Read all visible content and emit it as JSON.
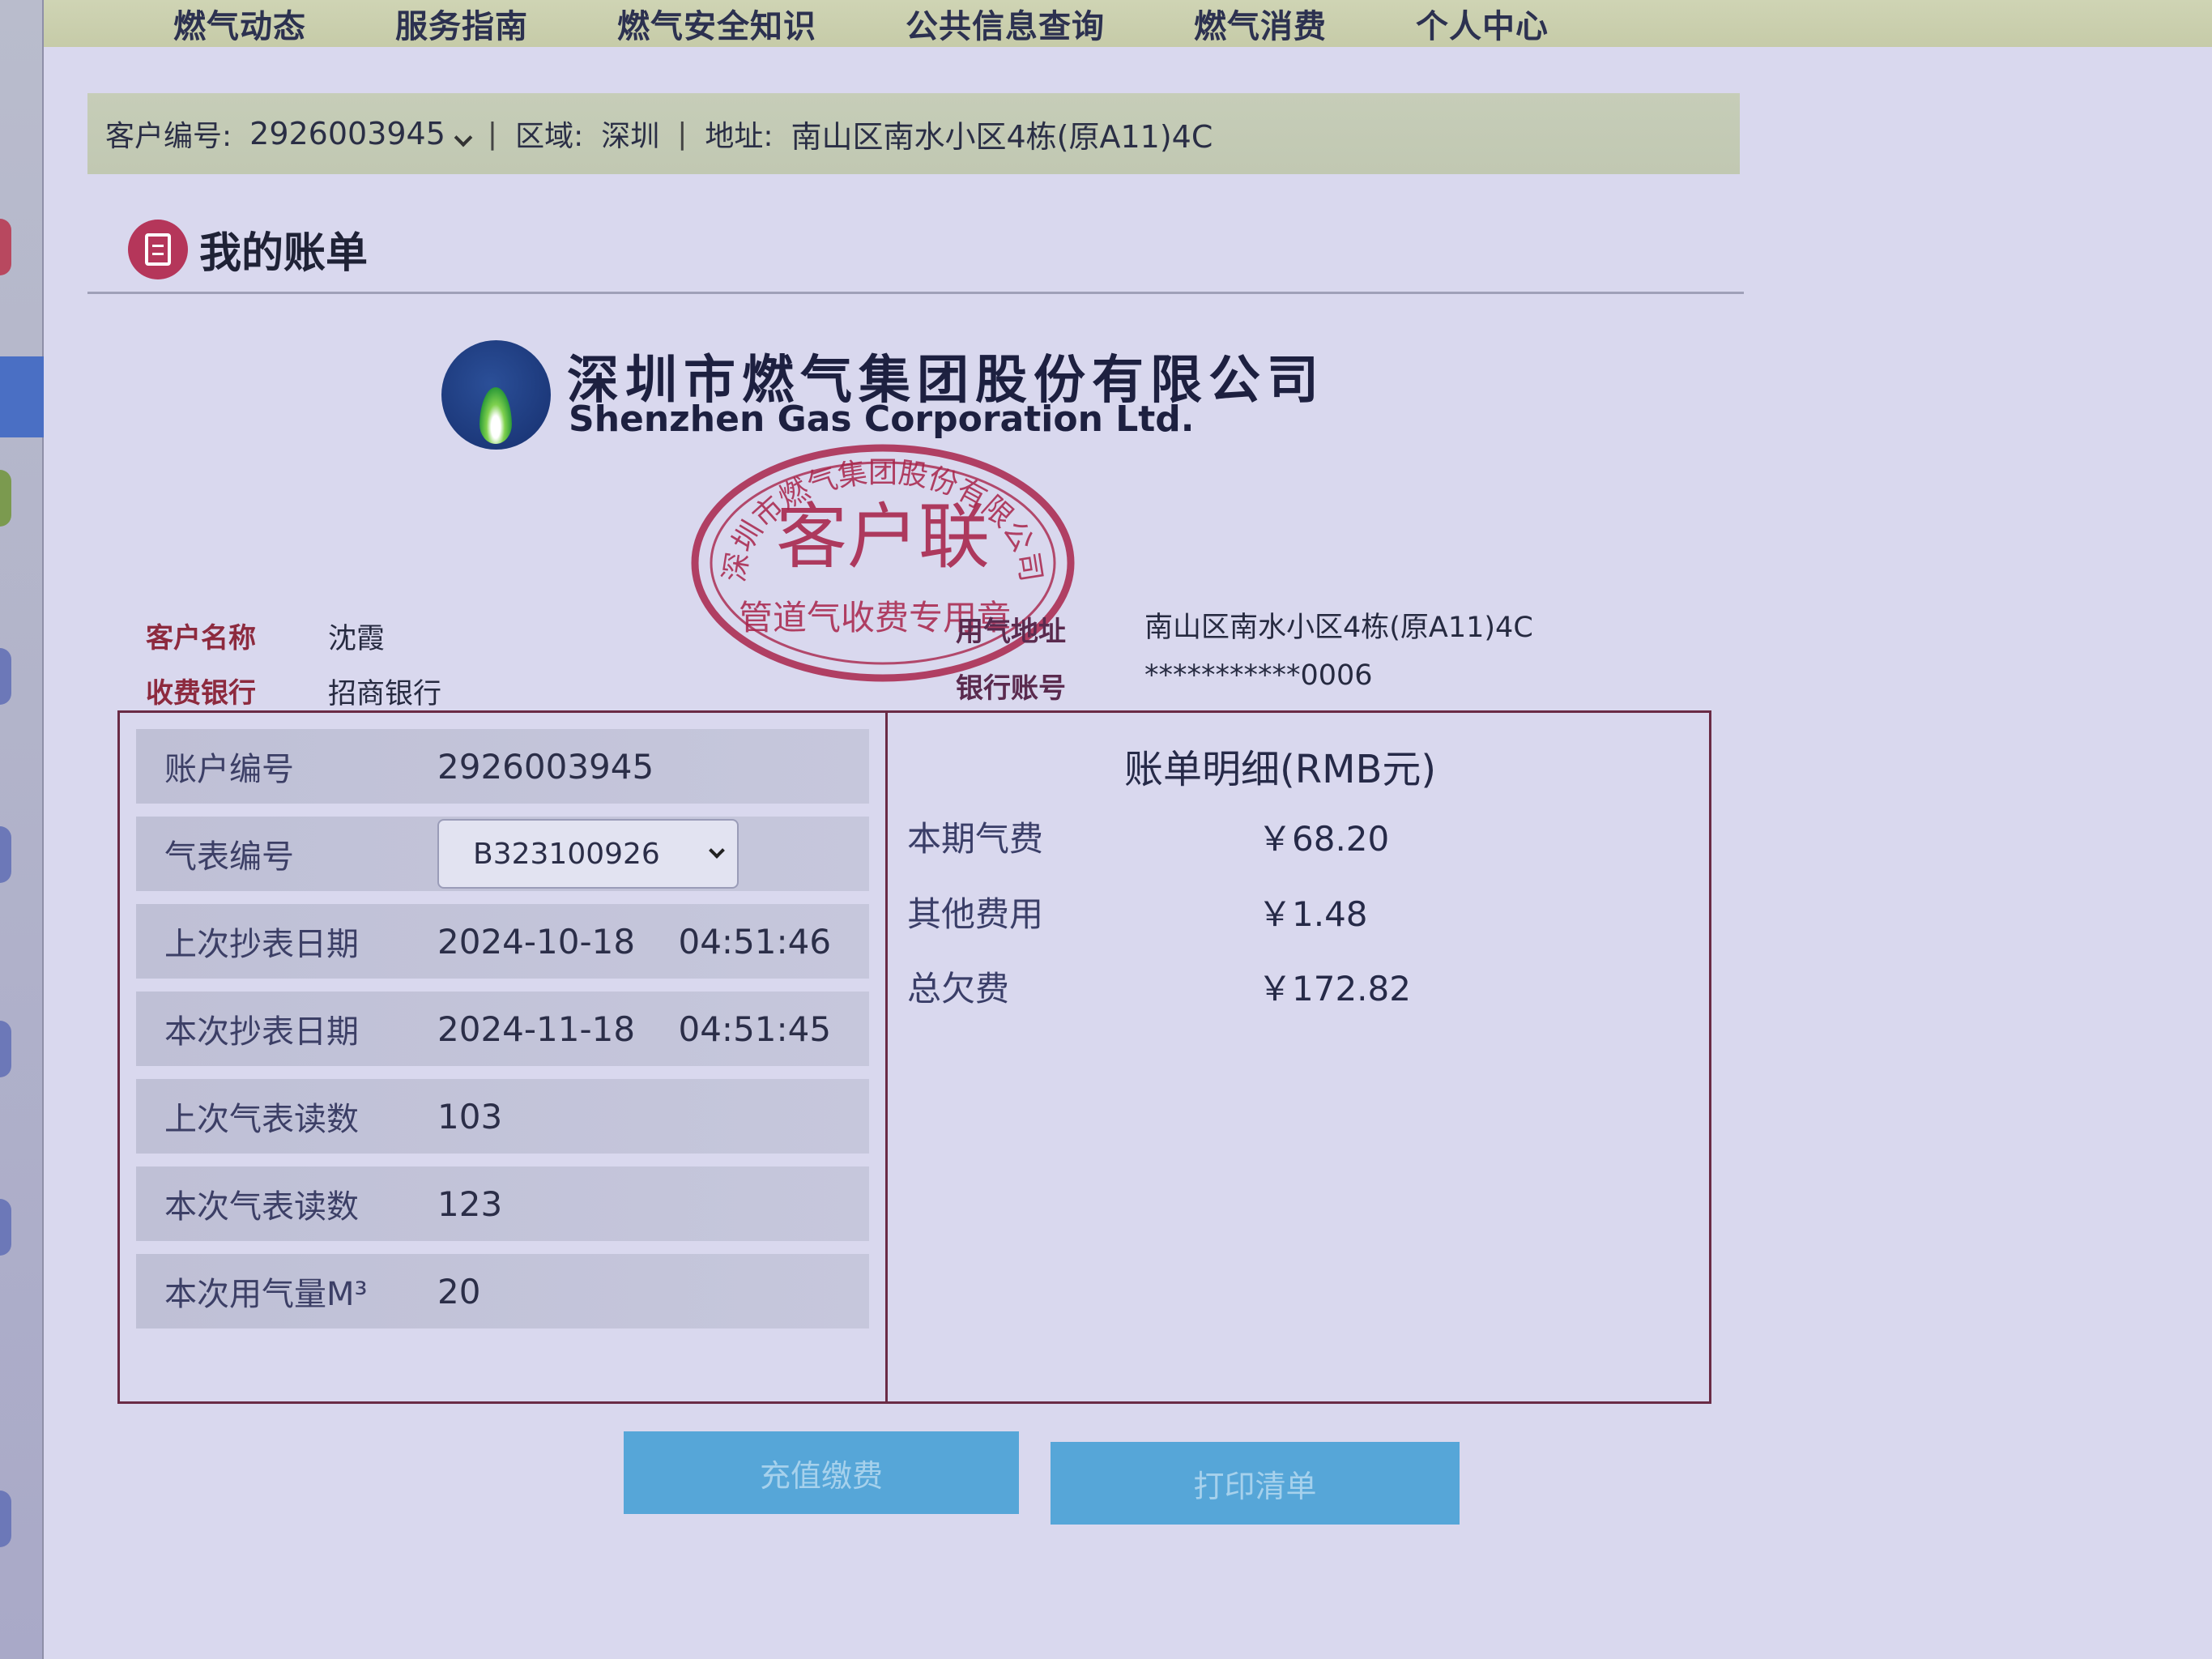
{
  "nav": {
    "items": [
      "燃气动态",
      "服务指南",
      "燃气安全知识",
      "公共信息查询",
      "燃气消费",
      "个人中心"
    ]
  },
  "account_bar": {
    "customer_no_label": "客户编号:",
    "customer_no": "2926003945",
    "region_label": "区域:",
    "region": "深圳",
    "address_label": "地址:",
    "address": "南山区南水小区4栋(原A11)4C"
  },
  "section": {
    "title": "我的账单"
  },
  "company": {
    "name_cn": "深圳市燃气集团股份有限公司",
    "name_en": "Shenzhen Gas Corporation Ltd."
  },
  "stamp": {
    "ring_text": "深圳市燃气集团股份有限公司",
    "center": "客户联",
    "bottom": "管道气收费专用章"
  },
  "customer_info": {
    "name_label": "客户名称",
    "name": "沈霞",
    "bank_label": "收费银行",
    "bank": "招商银行",
    "gas_address_label": "用气地址",
    "gas_address": "南山区南水小区4栋(原A11)4C",
    "bank_account_label": "银行账号",
    "bank_account": "***********0006"
  },
  "bill": {
    "account_no_label": "账户编号",
    "account_no": "2926003945",
    "meter_no_label": "气表编号",
    "meter_no": "B323100926",
    "last_read_date_label": "上次抄表日期",
    "last_read_date": "2024-10-18    04:51:46",
    "this_read_date_label": "本次抄表日期",
    "this_read_date": "2024-11-18    04:51:45",
    "last_reading_label": "上次气表读数",
    "last_reading": "103",
    "this_reading_label": "本次气表读数",
    "this_reading": "123",
    "usage_label": "本次用气量M³",
    "usage": "20"
  },
  "detail": {
    "title": "账单明细(RMB元)",
    "gas_fee_label": "本期气费",
    "gas_fee": "￥68.20",
    "other_fee_label": "其他费用",
    "other_fee": "￥1.48",
    "total_owed_label": "总欠费",
    "total_owed": "￥172.82"
  },
  "buttons": {
    "recharge": "充值缴费",
    "print": "打印清单"
  }
}
